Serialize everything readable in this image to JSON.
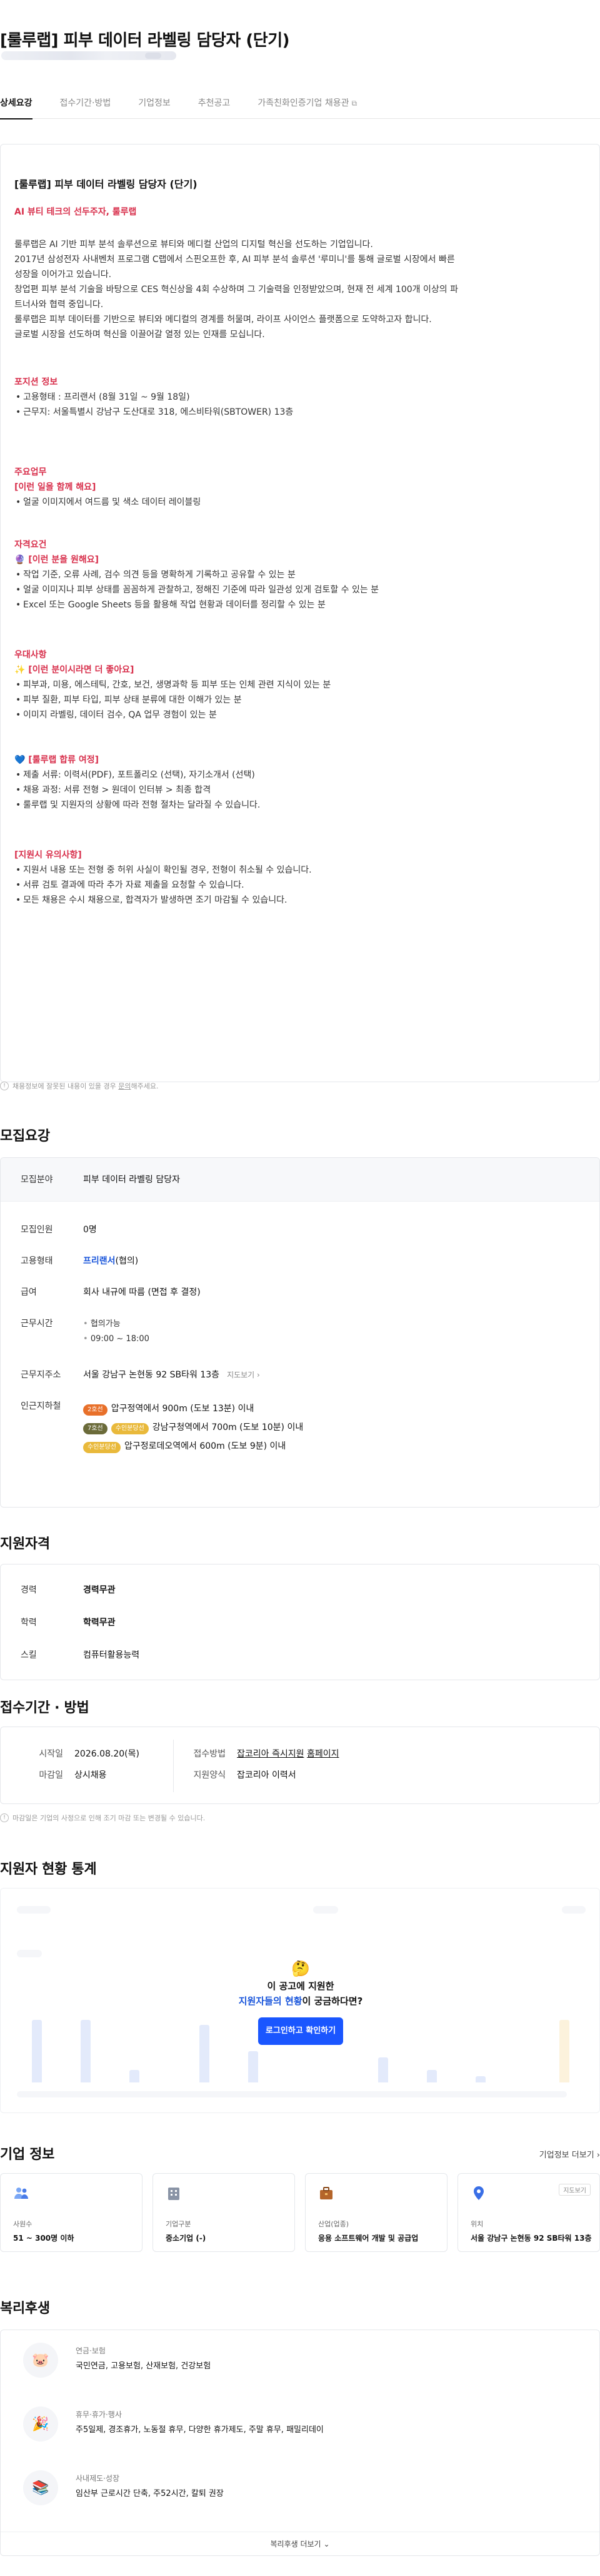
{
  "header": {
    "title": "[룰루랩] 피부 데이터 라벨링 담당자 (단기)"
  },
  "tabs": [
    "상세요강",
    "접수기간·방법",
    "기업정보",
    "추천공고",
    "가족친화인증기업 채용관"
  ],
  "detail": {
    "title": "[룰루랩] 피부 데이터 라벨링 담당자 (단기)",
    "tagline": "AI 뷰티 테크의 선두주자, 룰루랩",
    "intro": [
      "룰루랩은 AI 기반 피부 분석 솔루션으로 뷰티와 메디컬 산업의 디지털 혁신을 선도하는 기업입니다.",
      " 2017년 삼성전자 사내벤처 프로그램 C랩에서 스핀오프한 후, AI 피부 분석 솔루션 '루미니'를 통해 글로벌 시장에서 빠른",
      "성장을 이어가고 있습니다.",
      " 창업편 피부 분석 기술을 바탕으로 CES 혁신상을 4회 수상하며 그 기술력을 인정받았으며, 현재 전 세계 100개 이상의 파",
      "트너사와 협력 중입니다.",
      " 룰루랩은 피부 데이터를 기반으로 뷰티와 메디컬의 경계를 허물며, 라이프 사이언스 플랫폼으로 도약하고자 합니다.",
      " 글로벌 시장을 선도하며 혁신을 이끌어갈 열정 있는 인재를 모십니다."
    ],
    "pos_info_title": "포지션 정보",
    "pos_info": [
      "고용형태 : 프리랜서 (8월 31일 ~ 9월 18일)",
      "근무지: 서울특별시 강남구 도산대로 318, 에스비타워(SBTOWER) 13층"
    ],
    "task_title": "주요업무",
    "task_sub": "[이런 일을 함께 해요]",
    "tasks": [
      "얼굴 이미지에서 여드름 및 색소 데이터 레이블링"
    ],
    "req_title": "자격요건",
    "req_sub": "🔮 [이런 분을 원해요]",
    "reqs": [
      "작업 기준, 오류 사례, 검수 의견 등을 명확하게 기록하고 공유할 수 있는 분",
      "얼굴 이미지나 피부 상태를 꼼꼼하게 관찰하고, 정해진 기준에 따라 일관성 있게 검토할 수 있는 분",
      "Excel 또는 Google Sheets 등을 활용해 작업 현황과 데이터를 정리할 수 있는 분"
    ],
    "pref_title": "우대사항",
    "pref_sub": "✨ [이런 분이시라면 더 좋아요]",
    "prefs": [
      "피부과, 미용, 에스테틱, 간호, 보건, 생명과학 등 피부 또는 인체 관련 지식이 있는 분",
      "피부 질환, 피부 타입, 피부 상태 분류에 대한 이해가 있는 분",
      "이미지 라벨링, 데이터 검수, QA 업무 경험이 있는 분"
    ],
    "hire_sub": "💙 [룰루랩 합류 여정]",
    "hire": [
      "제출 서류: 이력서(PDF), 포트폴리오 (선택), 자기소개서 (선택)",
      "채용 과정: 서류 전형 > 원데이 인터뷰 > 최종 합격",
      "룰루랩 및 지원자의 상황에 따라 전형 절차는 달라질 수 있습니다."
    ],
    "caution_title": "[지원시 유의사항]",
    "cautions": [
      "지원서 내용 또는 전형 중 허위 사실이 확인될 경우, 전형이 취소될 수 있습니다.",
      "서류 검토 결과에 따라 추가 자료 제출을 요청할 수 있습니다.",
      "모든 채용은 수시 채용으로, 합격자가 발생하면 조기 마감될 수 있습니다."
    ]
  },
  "notice": {
    "pre": "채용정보에 잘못된 내용이 있을 경우 ",
    "link": "문의",
    "post": "해주세요."
  },
  "recruit": {
    "heading": "모집요강",
    "field_k": "모집분야",
    "field_v": "피부 데이터 라벨링 담당자",
    "count_k": "모집인원",
    "count_v": "0명",
    "type_k": "고용형태",
    "type_v": "프리랜서",
    "type_sfx": "(협의)",
    "pay_k": "급여",
    "pay_v": "회사 내규에 따름 (면접 후 결정)",
    "time_k": "근무시간",
    "time_1": "협의가능",
    "time_2": "09:00 ~ 18:00",
    "addr_k": "근무지주소",
    "addr_v": "서울 강남구 논현동 92 SB타워 13층",
    "addr_map": "지도보기",
    "near_k": "인근지하철",
    "near": [
      {
        "badge": "2호선",
        "text": "압구정역에서 900m (도보 13분) 이내"
      },
      {
        "badge": "7호선",
        "badge2": "수인분당선",
        "text": "강남구청역에서 700m (도보 10분) 이내"
      },
      {
        "badge": "수인분당선",
        "text": "압구정로데오역에서 600m (도보 9분) 이내"
      }
    ]
  },
  "qual": {
    "heading": "지원자격",
    "career_k": "경력",
    "career_v": "경력무관",
    "edu_k": "학력",
    "edu_v": "학력무관",
    "skill_k": "스킬",
    "skill_v": "컴퓨터활용능력"
  },
  "apply": {
    "heading": "접수기간 · 방법",
    "start_k": "시작일",
    "start_v": "2026.08.20(목)",
    "end_k": "마감일",
    "end_v": "상시채용",
    "method_k": "접수방법",
    "method_v": "잡코리아 즉시지원",
    "method_v2": "홈페이지",
    "form_k": "지원양식",
    "form_v": "잡코리아 이력서",
    "note": "마감일은 기업의 사정으로 인해 조기 마감 또는 변경될 수 있습니다."
  },
  "stats": {
    "heading": "지원자 현황 통계",
    "emoji": "🤔",
    "cta_line1": "이 공고에 지원한",
    "cta_line2_blue": "지원자들의 현황",
    "cta_line2_rest": "이 궁금하다면?",
    "cta_btn": "로그인하고 확인하기"
  },
  "company": {
    "heading": "기업 정보",
    "more": "기업정보 더보기",
    "cards": [
      {
        "label": "사원수",
        "value": "51 ~ 300명 이하",
        "icon": "people-icon"
      },
      {
        "label": "기업구분",
        "value": "중소기업 (-)",
        "icon": "building-icon"
      },
      {
        "label": "산업(업종)",
        "value": "응용 소프트웨어 개발 및 공급업",
        "icon": "briefcase-icon"
      },
      {
        "label": "위치",
        "value": "서울 강남구 논현동 92 SB타워 13층",
        "icon": "location-pin-icon",
        "btn": "지도보기"
      }
    ]
  },
  "benefits": {
    "heading": "복리후생",
    "items": [
      {
        "k": "연금·보험",
        "v": "국민연금, 고용보험, 산재보험, 건강보험",
        "icon": "piggy-bank-icon"
      },
      {
        "k": "휴무·휴가·행사",
        "v": "주5일제, 경조휴가, 노동절 휴무, 다양한 휴가제도, 주말 휴무, 패밀리데이",
        "icon": "party-popper-icon"
      },
      {
        "k": "사내제도·성장",
        "v": "임산부 근로시간 단축, 주52시간, 칼퇴 권장",
        "icon": "books-icon"
      }
    ],
    "more": "복리후생 더보기"
  }
}
